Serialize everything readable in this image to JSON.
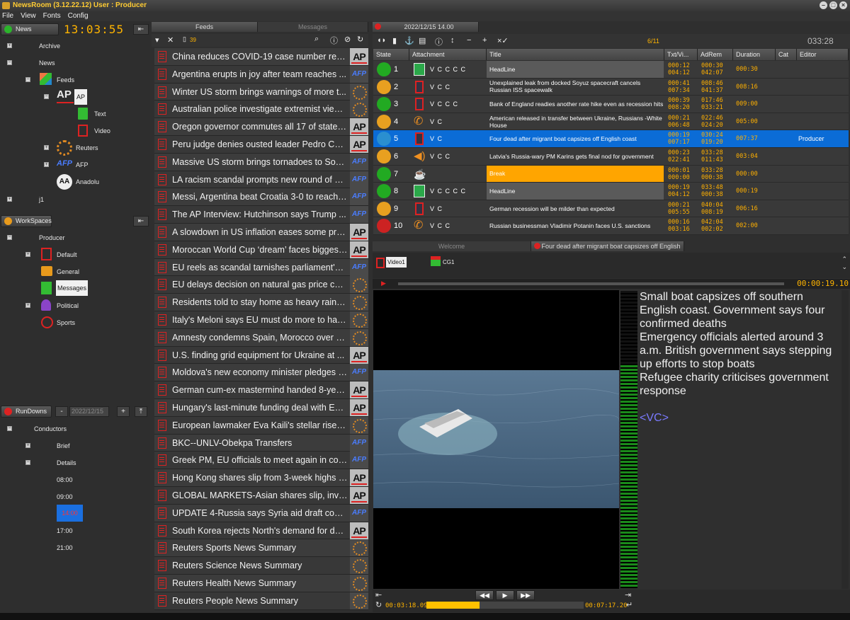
{
  "app": {
    "title": "NewsRoom  (3.12.22.12) User : Producer"
  },
  "menu": [
    "File",
    "View",
    "Fonts",
    "Config"
  ],
  "left": {
    "news_button": "News",
    "clock": "13:03:55",
    "tree": {
      "archive": "Archive",
      "news": "News",
      "feeds": "Feeds",
      "ap": "AP",
      "text": "Text",
      "video": "Video",
      "reuters": "Reuters",
      "afp": "AFP",
      "anadolu": "Anadolu",
      "j1": "j1"
    },
    "workspaces_button": "WorkSpaces",
    "ws_tree": {
      "producer": "Producer",
      "default": "Default",
      "general": "General",
      "messages": "Messages",
      "political": "Political",
      "sports": "Sports"
    },
    "rundowns_button": "RunDowns",
    "rundown_date": "2022/12/15",
    "minus": "-",
    "plus": "+",
    "rd_tree": {
      "conductors": "Conductors",
      "brief": "Brief",
      "details": "Details",
      "t0800": "08:00",
      "t0900": "09:00",
      "t1400": "14:00",
      "t1700": "17:00",
      "t2100": "21:00"
    }
  },
  "feeds": {
    "tab_feeds": "Feeds",
    "tab_messages": "Messages",
    "count": "39",
    "items": [
      {
        "title": "China reduces COVID-19 case number repo...",
        "src": "ap"
      },
      {
        "title": "Argentina erupts in joy after team reaches ...",
        "src": "afp"
      },
      {
        "title": "Winter US storm brings warnings of more t...",
        "src": "reuters"
      },
      {
        "title": "Australian police investigate extremist views...",
        "src": "reuters"
      },
      {
        "title": "Oregon governor commutes all 17 of state's...",
        "src": "ap"
      },
      {
        "title": "Peru judge denies ousted leader Pedro Casti...",
        "src": "ap"
      },
      {
        "title": "Massive US storm brings tornadoes to Sout...",
        "src": "afp"
      },
      {
        "title": "LA racism scandal prompts new round of cit...",
        "src": "afp"
      },
      {
        "title": "Messi, Argentina beat Croatia 3-0 to reach ...",
        "src": "afp"
      },
      {
        "title": "The AP Interview: Hutchinson says Trump ...",
        "src": "afp"
      },
      {
        "title": "A slowdown in US inflation eases some pre...",
        "src": "ap"
      },
      {
        "title": "Moroccan World Cup ‘dream’ faces biggest t...",
        "src": "ap"
      },
      {
        "title": "EU reels as scandal tarnishes parliament's cr...",
        "src": "afp"
      },
      {
        "title": "EU delays decision on natural gas price cap,...",
        "src": "reuters"
      },
      {
        "title": "Residents told to stay home as heavy rain, f...",
        "src": "reuters"
      },
      {
        "title": "Italy's Meloni says EU must do more to halt ...",
        "src": "reuters"
      },
      {
        "title": "Amnesty condemns Spain, Morocco over M...",
        "src": "reuters"
      },
      {
        "title": "U.S. finding grid equipment for Ukraine at ...",
        "src": "ap"
      },
      {
        "title": "Moldova's new economy minister pledges p...",
        "src": "afp"
      },
      {
        "title": "German cum-ex mastermind handed 8-year...",
        "src": "ap"
      },
      {
        "title": "Hungary's last-minute funding deal with EU ...",
        "src": "ap"
      },
      {
        "title": "European lawmaker Eva Kaili's stellar rise hi...",
        "src": "reuters"
      },
      {
        "title": "BKC--UNLV-Obekpa Transfers",
        "src": "afp"
      },
      {
        "title": "Greek PM, EU officials to meet again in com...",
        "src": "afp"
      },
      {
        "title": "Hong Kong shares slip from 3-week highs a...",
        "src": "ap"
      },
      {
        "title": "GLOBAL MARKETS-Asian shares slip, invest...",
        "src": "ap"
      },
      {
        "title": "UPDATE 4-Russia says Syria aid draft could...",
        "src": "afp"
      },
      {
        "title": "South Korea rejects North's demand for del...",
        "src": "ap"
      },
      {
        "title": "Reuters Sports News Summary",
        "src": "reuters"
      },
      {
        "title": "Reuters Science News Summary",
        "src": "reuters"
      },
      {
        "title": "Reuters Health News Summary",
        "src": "reuters"
      },
      {
        "title": "Reuters People News Summary",
        "src": "reuters"
      }
    ]
  },
  "rundown": {
    "tab": "2022/12/15  14.00",
    "counter": "6/11",
    "total": "033:28",
    "headers": [
      "State",
      "Attachment",
      "Title",
      "Txt/Vi...",
      "AdRem",
      "Duration",
      "Cat",
      "Editor"
    ],
    "rows": [
      {
        "n": "1",
        "att": "V C C C C",
        "title": "HeadLine",
        "t1": "000:12",
        "t2": "004:12",
        "a1": "000:30",
        "a2": "042:07",
        "dur": "000:30",
        "editor": "",
        "style": "gray",
        "state": "#22aa22",
        "aico": "list"
      },
      {
        "n": "2",
        "att": "V C C",
        "title": "Unexplained leak from docked Soyuz spacecraft cancels Russian ISS spacewalk",
        "t1": "000:41",
        "t2": "007:34",
        "a1": "008:46",
        "a2": "041:37",
        "dur": "008:16",
        "editor": "",
        "style": "",
        "state": "#e8a020",
        "aico": "pad"
      },
      {
        "n": "3",
        "att": "V C C C",
        "title": "Bank of England readies another rate hike even as recession hits",
        "t1": "000:39",
        "t2": "008:20",
        "a1": "017:46",
        "a2": "033:21",
        "dur": "009:00",
        "editor": "",
        "style": "",
        "state": "#22aa22",
        "aico": "pad"
      },
      {
        "n": "4",
        "att": "V C",
        "title": "American released in transfer between Ukraine, Russians -White House",
        "t1": "000:21",
        "t2": "006:48",
        "a1": "022:46",
        "a2": "024:20",
        "dur": "005:00",
        "editor": "",
        "style": "",
        "state": "#e8a020",
        "aico": "phone"
      },
      {
        "n": "5",
        "att": "V C",
        "title": "Four dead after migrant boat capsizes off English coast",
        "t1": "000:19",
        "t2": "007:17",
        "a1": "030:24",
        "a2": "019:20",
        "dur": "007:37",
        "editor": "Producer",
        "style": "sel",
        "state": "#2a8fd0",
        "aico": "pad"
      },
      {
        "n": "6",
        "att": "V C C",
        "title": "Latvia's Russia-wary PM Karins gets final nod for government",
        "t1": "000:23",
        "t2": "022:41",
        "a1": "033:28",
        "a2": "011:43",
        "dur": "003:04",
        "editor": "",
        "style": "",
        "state": "#e8a020",
        "aico": "speaker"
      },
      {
        "n": "7",
        "att": "",
        "title": "Break",
        "t1": "000:01",
        "t2": "000:00",
        "a1": "033:28",
        "a2": "000:38",
        "dur": "000:00",
        "editor": "",
        "style": "orange",
        "state": "#22aa22",
        "aico": "cup"
      },
      {
        "n": "8",
        "att": "V C C C C",
        "title": "HeadLine",
        "t1": "000:19",
        "t2": "004:12",
        "a1": "033:48",
        "a2": "000:38",
        "dur": "000:19",
        "editor": "",
        "style": "gray",
        "state": "#22aa22",
        "aico": "list"
      },
      {
        "n": "9",
        "att": "V C",
        "title": "German recession will be milder than expected",
        "t1": "000:21",
        "t2": "005:55",
        "a1": "040:04",
        "a2": "008:19",
        "dur": "006:16",
        "editor": "",
        "style": "",
        "state": "#e8a020",
        "aico": "pad"
      },
      {
        "n": "10",
        "att": "V C C",
        "title": "Russian businessman Vladimir Potanin faces U.S. sanctions",
        "t1": "000:16",
        "t2": "003:16",
        "a1": "042:04",
        "a2": "002:02",
        "dur": "002:00",
        "editor": "",
        "style": "",
        "state": "#cc2222",
        "aico": "phone"
      }
    ]
  },
  "story": {
    "tab_welcome": "Welcome",
    "tab_story": "Four dead after migrant boat capsizes off English",
    "video_label": "Video1",
    "cg_label": "CG1",
    "timecode": "00:00:19.10",
    "time_left": "00:03:18.09",
    "time_right": "00:07:17.20",
    "progress": 0.34,
    "text": [
      "Small boat capsizes off southern English coast. Government says four confirmed deaths",
      "Emergency officials alerted around 3 a.m. British government says stepping up efforts to stop boats",
      "Refugee charity criticises government response"
    ],
    "tag": "<VC>"
  },
  "colors": {
    "accent": "#ffb400",
    "selection": "#0b6cd6",
    "break": "#ffa500"
  }
}
